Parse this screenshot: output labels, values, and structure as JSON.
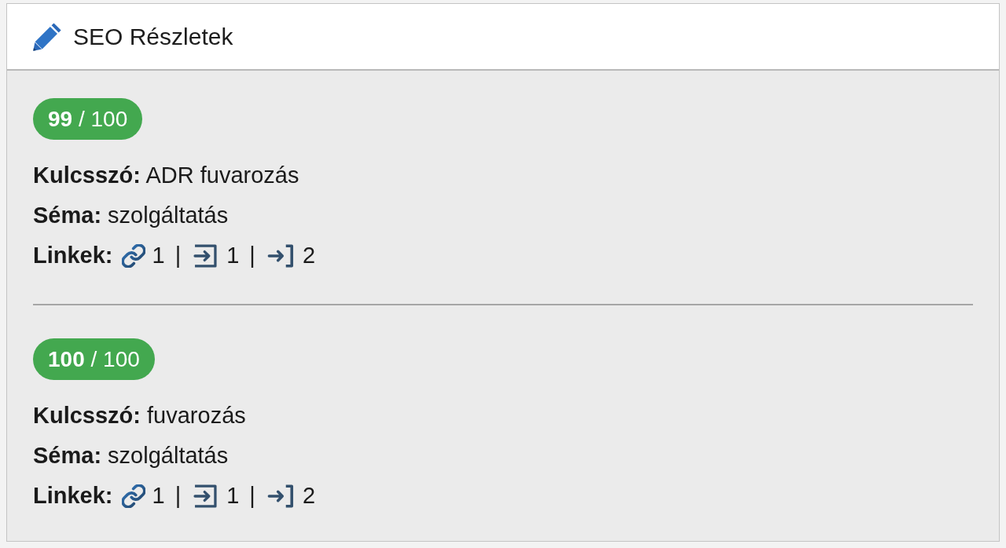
{
  "card": {
    "title": "SEO Részletek"
  },
  "entries": [
    {
      "score": "**99** / 100",
      "fields": [
        "**Kulcsszó:** ADR fuvarozás",
        "**Séma:** szolgáltatás"
      ],
      "links": {
        "label": "Linkek:",
        "separator": "|",
        "items": [
          {
            "kind": "chain",
            "count": "1"
          },
          {
            "kind": "box-in",
            "count": "1"
          },
          {
            "kind": "bracket-in",
            "count": "2"
          }
        ]
      }
    },
    {
      "score": "**100** / 100",
      "fields": [
        "**Kulcsszó:** fuvarozás",
        "**Séma:** szolgáltatás"
      ],
      "links": {
        "label": "Linkek:",
        "separator": "|",
        "items": [
          {
            "kind": "chain",
            "count": "1"
          },
          {
            "kind": "box-in",
            "count": "1"
          },
          {
            "kind": "bracket-in",
            "count": "2"
          }
        ]
      }
    }
  ]
}
